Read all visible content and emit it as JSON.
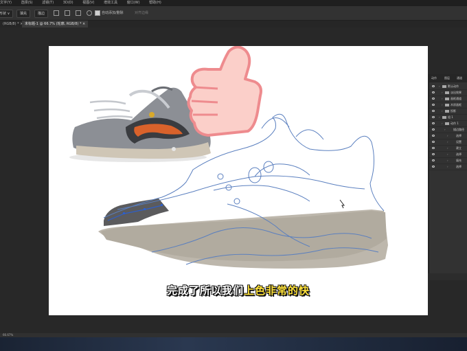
{
  "menu": [
    "文字(Y)",
    "选择(S)",
    "滤镜(T)",
    "3D(D)",
    "视图(V)",
    "增效工具",
    "窗口(W)",
    "帮助(H)"
  ],
  "options": {
    "preset": "形状 ∨",
    "fill_label": "填充",
    "stroke_label": "描边",
    "auto_add_delete": "自动添加/删除",
    "align_edges": "对齐边缘"
  },
  "tabs": [
    {
      "label": "(RGB/8) * ×",
      "active": false
    },
    {
      "label": "未标题-1 @ 66.7% (轮廓, RGB/8) * ×",
      "active": true
    }
  ],
  "subtitle": {
    "white": "完成了所以我们",
    "yellow": "上色非常的快"
  },
  "layers_panel": {
    "tabs": [
      "动作",
      "图层",
      "通道"
    ],
    "rows": [
      {
        "indent": 0,
        "name": "默认动作"
      },
      {
        "indent": 1,
        "name": "淡出效果"
      },
      {
        "indent": 1,
        "name": "画框通道"
      },
      {
        "indent": 1,
        "name": "木质画框"
      },
      {
        "indent": 1,
        "name": "投影"
      },
      {
        "indent": 0,
        "name": "组 1"
      },
      {
        "indent": 1,
        "name": "动作 1"
      },
      {
        "indent": 2,
        "name": "描边路径"
      },
      {
        "indent": 3,
        "name": "选择"
      },
      {
        "indent": 3,
        "name": "设置"
      },
      {
        "indent": 3,
        "name": "建立"
      },
      {
        "indent": 3,
        "name": "选择"
      },
      {
        "indent": 3,
        "name": "填充"
      },
      {
        "indent": 3,
        "name": "选择"
      }
    ]
  },
  "status": "66.67%"
}
